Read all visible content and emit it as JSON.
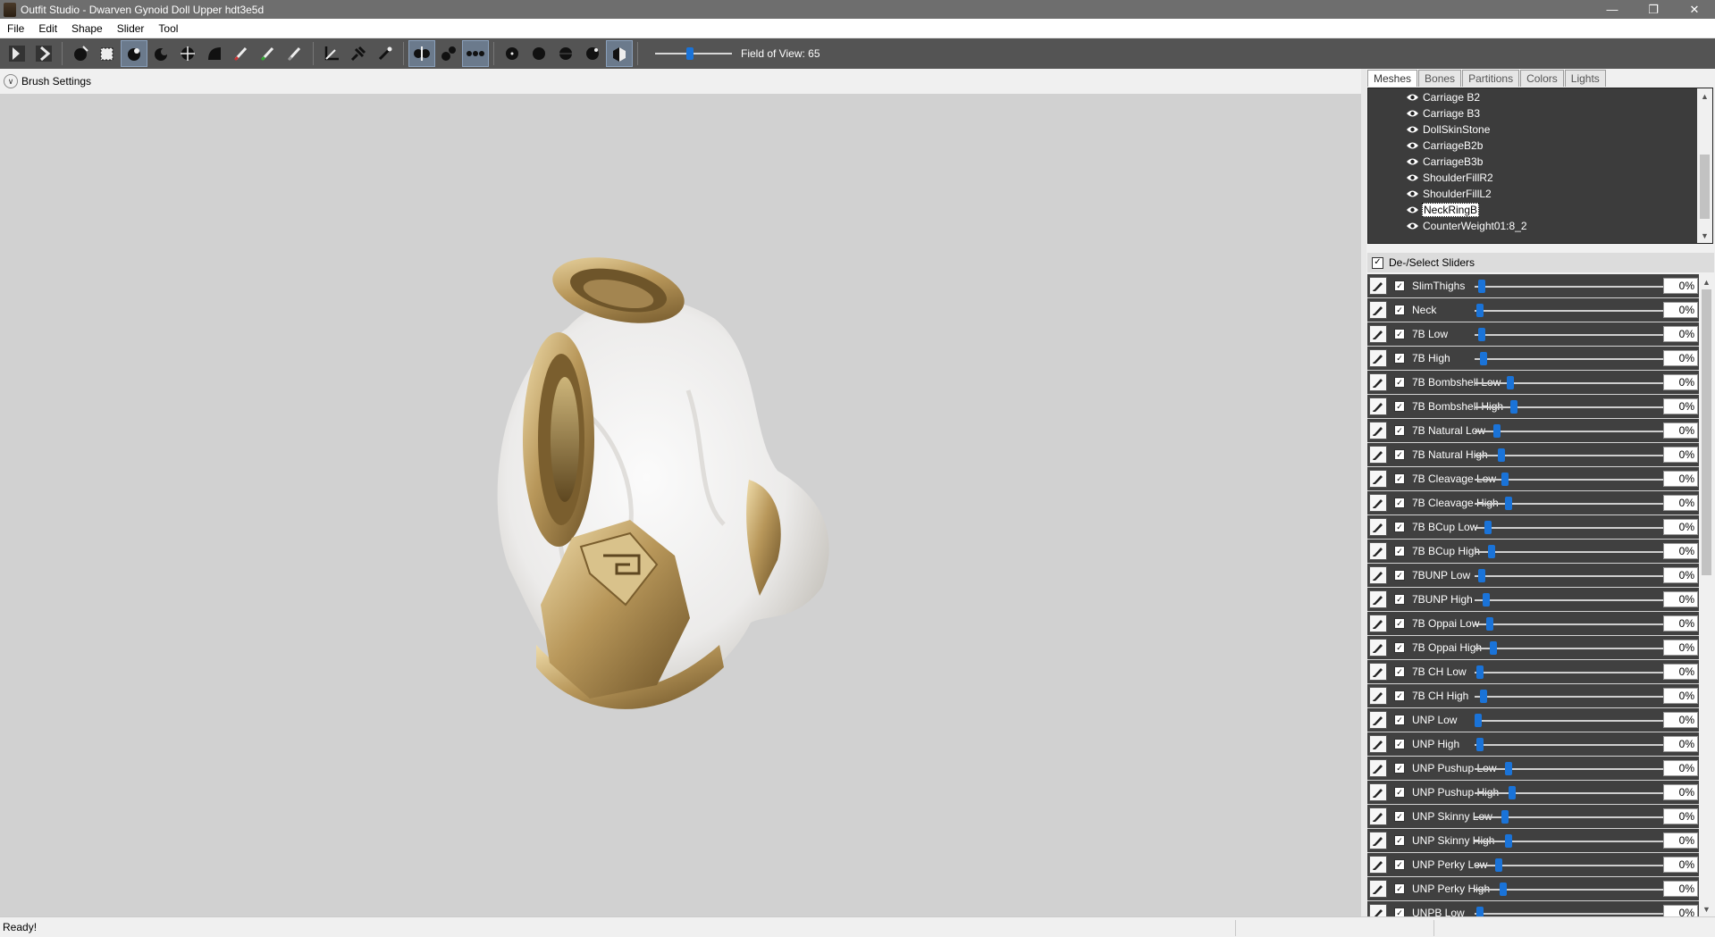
{
  "window": {
    "title": "Outfit Studio - Dwarven Gynoid Doll Upper hdt3e5d",
    "minimize": "—",
    "maximize": "❐",
    "close": "✕"
  },
  "menu": [
    "File",
    "Edit",
    "Shape",
    "Slider",
    "Tool"
  ],
  "toolbar": {
    "fov_label": "Field of View: 65",
    "fov_value": 0.45
  },
  "brush_settings": {
    "label": "Brush Settings"
  },
  "tabs": [
    "Meshes",
    "Bones",
    "Partitions",
    "Colors",
    "Lights"
  ],
  "meshes": [
    {
      "name": "Carriage B2",
      "selected": false
    },
    {
      "name": "Carriage B3",
      "selected": false
    },
    {
      "name": "DollSkinStone",
      "selected": false
    },
    {
      "name": "CarriageB2b",
      "selected": false
    },
    {
      "name": "CarriageB3b",
      "selected": false
    },
    {
      "name": "ShoulderFillR2",
      "selected": false
    },
    {
      "name": "ShoulderFillL2",
      "selected": false
    },
    {
      "name": "NeckRingB",
      "selected": true
    },
    {
      "name": "CounterWeight01:8_2",
      "selected": false
    }
  ],
  "deselect_label": "De-/Select Sliders",
  "sliders": [
    {
      "name": "SlimThighs",
      "value": "0%"
    },
    {
      "name": "Neck",
      "value": "0%"
    },
    {
      "name": "7B Low",
      "value": "0%"
    },
    {
      "name": "7B High",
      "value": "0%"
    },
    {
      "name": "7B Bombshell Low",
      "value": "0%"
    },
    {
      "name": "7B Bombshell High",
      "value": "0%"
    },
    {
      "name": "7B Natural Low",
      "value": "0%"
    },
    {
      "name": "7B Natural High",
      "value": "0%"
    },
    {
      "name": "7B Cleavage Low",
      "value": "0%"
    },
    {
      "name": "7B Cleavage High",
      "value": "0%"
    },
    {
      "name": "7B BCup Low",
      "value": "0%"
    },
    {
      "name": "7B BCup High",
      "value": "0%"
    },
    {
      "name": "7BUNP Low",
      "value": "0%"
    },
    {
      "name": "7BUNP High",
      "value": "0%"
    },
    {
      "name": "7B Oppai Low",
      "value": "0%"
    },
    {
      "name": "7B Oppai High",
      "value": "0%"
    },
    {
      "name": "7B CH Low",
      "value": "0%"
    },
    {
      "name": "7B CH High",
      "value": "0%"
    },
    {
      "name": "UNP Low",
      "value": "0%"
    },
    {
      "name": "UNP High",
      "value": "0%"
    },
    {
      "name": "UNP Pushup Low",
      "value": "0%"
    },
    {
      "name": "UNP Pushup High",
      "value": "0%"
    },
    {
      "name": "UNP Skinny Low",
      "value": "0%"
    },
    {
      "name": "UNP Skinny High",
      "value": "0%"
    },
    {
      "name": "UNP Perky Low",
      "value": "0%"
    },
    {
      "name": "UNP Perky High",
      "value": "0%"
    },
    {
      "name": "UNPB Low",
      "value": "0%"
    }
  ],
  "status": {
    "text": "Ready!"
  },
  "colors": {
    "accent": "#1a73d8",
    "toolbar": "#545454",
    "viewport": "#d1d1d1"
  }
}
